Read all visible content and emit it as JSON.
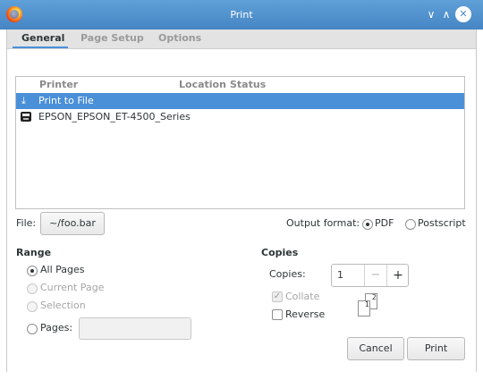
{
  "window": {
    "title": "Print"
  },
  "tabs": [
    {
      "label": "General",
      "active": true
    },
    {
      "label": "Page Setup",
      "active": false
    },
    {
      "label": "Options",
      "active": false
    }
  ],
  "printer_list": {
    "columns": [
      "Printer",
      "Location",
      "Status"
    ],
    "rows": [
      {
        "name": "Print to File",
        "icon": "download-icon",
        "selected": true
      },
      {
        "name": "EPSON_EPSON_ET-4500_Series",
        "icon": "printer-icon",
        "selected": false
      }
    ]
  },
  "file": {
    "label": "File:",
    "value": "~/foo.bar"
  },
  "output_format": {
    "label": "Output format:",
    "options": [
      "PDF",
      "Postscript"
    ],
    "selected": "PDF"
  },
  "range": {
    "heading": "Range",
    "options": [
      {
        "label": "All Pages",
        "selected": true,
        "enabled": true
      },
      {
        "label": "Current Page",
        "selected": false,
        "enabled": false
      },
      {
        "label": "Selection",
        "selected": false,
        "enabled": false
      },
      {
        "label": "Pages:",
        "selected": false,
        "enabled": true
      }
    ],
    "pages_value": ""
  },
  "copies": {
    "heading": "Copies",
    "label": "Copies:",
    "value": "1",
    "minus": "−",
    "plus": "+",
    "collate": {
      "label": "Collate",
      "checked": true,
      "enabled": false
    },
    "reverse": {
      "label": "Reverse",
      "checked": false,
      "enabled": true
    },
    "page_numbers": [
      "1",
      "2"
    ]
  },
  "actions": {
    "cancel": "Cancel",
    "print": "Print"
  },
  "colors": {
    "accent": "#4a90d9",
    "titlebar": "#4585c4"
  }
}
